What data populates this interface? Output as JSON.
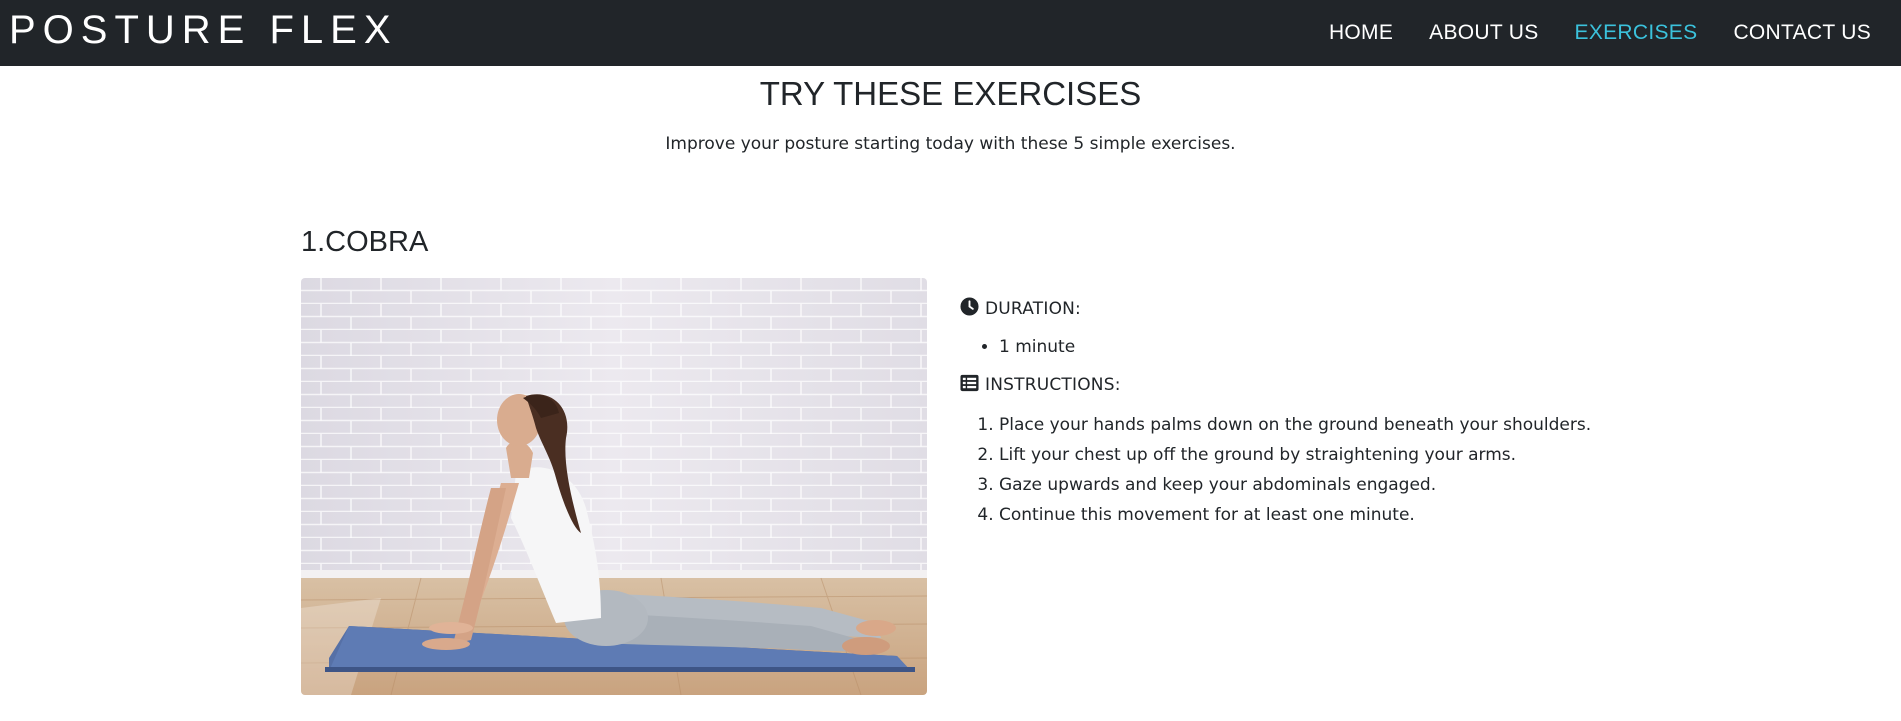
{
  "navbar": {
    "brand": "POSTURE FLEX",
    "links": [
      {
        "label": "HOME",
        "active": false
      },
      {
        "label": "ABOUT US",
        "active": false
      },
      {
        "label": "EXERCISES",
        "active": true
      },
      {
        "label": "CONTACT US",
        "active": false
      }
    ],
    "background_color": "#212529",
    "active_color": "#3bc2dc"
  },
  "hero": {
    "title": "TRY THESE EXERCISES",
    "subtitle": "Improve your posture starting today with these 5 simple exercises."
  },
  "exercise": {
    "title": "1.COBRA",
    "duration_label": "DURATION:",
    "duration_items": [
      "1 minute"
    ],
    "instructions_label": "INSTRUCTIONS:",
    "instructions": [
      "Place your hands palms down on the ground beneath your shoulders.",
      "Lift your chest up off the ground by straightening your arms.",
      "Gaze upwards and keep your abdominals engaged.",
      "Continue this movement for at least one minute."
    ],
    "icons": {
      "duration": "clock-icon",
      "instructions": "list-icon"
    }
  }
}
